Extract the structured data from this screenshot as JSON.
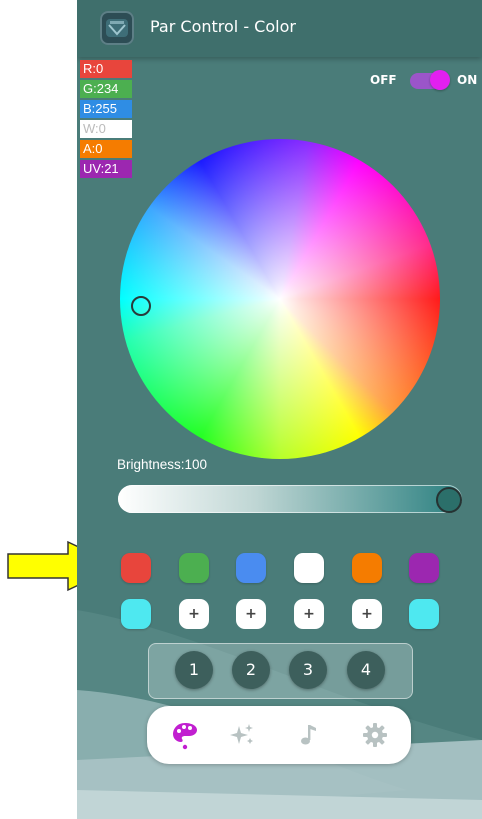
{
  "app": {
    "title": "Par Control - Color"
  },
  "channels": [
    {
      "id": "r",
      "text": "R:0",
      "color": "#e8453c"
    },
    {
      "id": "g",
      "text": "G:234",
      "color": "#4caf50"
    },
    {
      "id": "b",
      "text": "B:255",
      "color": "#2f8de4"
    },
    {
      "id": "w",
      "text": "W:0",
      "color": "#ffffff"
    },
    {
      "id": "a",
      "text": "A:0",
      "color": "#f57c00"
    },
    {
      "id": "uv",
      "text": "UV:21",
      "color": "#9c27b0"
    }
  ],
  "power": {
    "off_label": "OFF",
    "on_label": "ON",
    "state": "on",
    "accent": "#e21ff0"
  },
  "brightness": {
    "label": "Brightness:100",
    "value": 100
  },
  "swatches": {
    "row1": [
      "#e8453c",
      "#4caf50",
      "#4a8cf0",
      "#ffffff",
      "#f57c00",
      "#9c27b0"
    ],
    "row2": [
      {
        "type": "color",
        "color": "#4ee8f0"
      },
      {
        "type": "add",
        "label": "+"
      },
      {
        "type": "add",
        "label": "+"
      },
      {
        "type": "add",
        "label": "+"
      },
      {
        "type": "add",
        "label": "+"
      },
      {
        "type": "color",
        "color": "#4ee8f0"
      }
    ]
  },
  "scenes": [
    "1",
    "2",
    "3",
    "4"
  ],
  "nav": {
    "items": [
      {
        "icon": "palette-icon",
        "active": true,
        "color": "#c11fd0"
      },
      {
        "icon": "sparkles-icon",
        "active": false
      },
      {
        "icon": "music-note-icon",
        "active": false
      },
      {
        "icon": "gear-icon",
        "active": false
      }
    ]
  },
  "annotation": {
    "icon": "yellow-arrow-icon",
    "color": "#ffff00"
  }
}
